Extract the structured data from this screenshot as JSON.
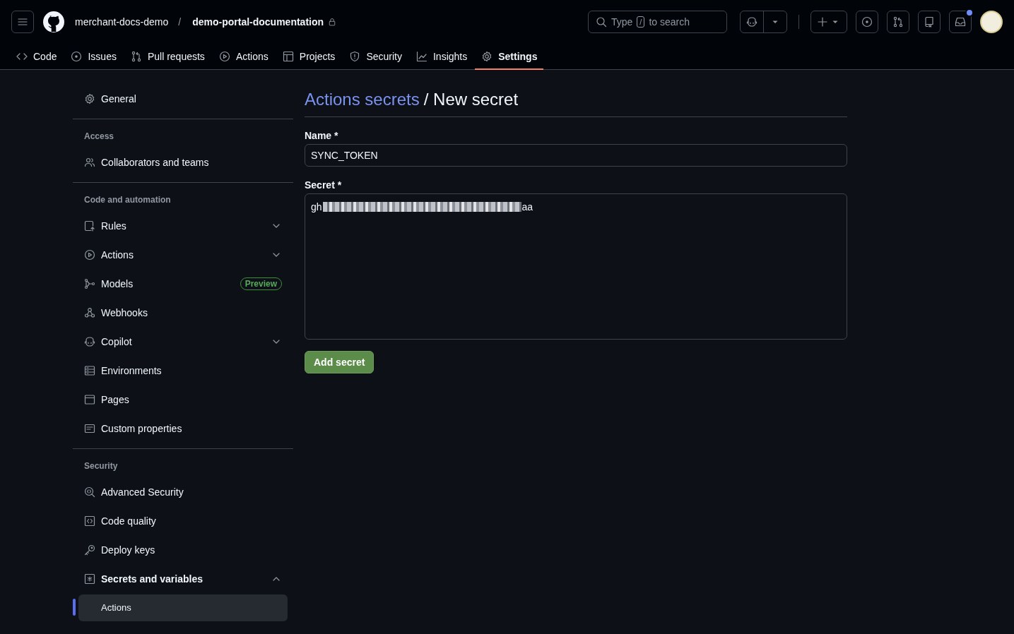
{
  "header": {
    "owner": "merchant-docs-demo",
    "separator": "/",
    "repo": "demo-portal-documentation",
    "private": true,
    "search": {
      "placeholder_before": "Type",
      "key": "/",
      "placeholder_after": "to search"
    },
    "notifications": {
      "unread": true
    }
  },
  "tabs": [
    {
      "label": "Code",
      "selected": false
    },
    {
      "label": "Issues",
      "selected": false
    },
    {
      "label": "Pull requests",
      "selected": false
    },
    {
      "label": "Actions",
      "selected": false
    },
    {
      "label": "Projects",
      "selected": false
    },
    {
      "label": "Security",
      "selected": false
    },
    {
      "label": "Insights",
      "selected": false
    },
    {
      "label": "Settings",
      "selected": true
    }
  ],
  "sidebar": {
    "sections": [
      {
        "items": [
          {
            "label": "General",
            "kind": "link"
          }
        ]
      },
      {
        "heading": "Access",
        "items": [
          {
            "label": "Collaborators and teams",
            "kind": "link"
          }
        ]
      },
      {
        "heading": "Code and automation",
        "items": [
          {
            "label": "Rules",
            "kind": "group",
            "expanded": false
          },
          {
            "label": "Actions",
            "kind": "group",
            "expanded": false
          },
          {
            "label": "Models",
            "kind": "link",
            "badge": "Preview"
          },
          {
            "label": "Webhooks",
            "kind": "link"
          },
          {
            "label": "Copilot",
            "kind": "group",
            "expanded": false
          },
          {
            "label": "Environments",
            "kind": "link"
          },
          {
            "label": "Pages",
            "kind": "link"
          },
          {
            "label": "Custom properties",
            "kind": "link"
          }
        ]
      },
      {
        "heading": "Security",
        "items": [
          {
            "label": "Advanced Security",
            "kind": "link"
          },
          {
            "label": "Code quality",
            "kind": "link"
          },
          {
            "label": "Deploy keys",
            "kind": "link"
          },
          {
            "label": "Secrets and variables",
            "kind": "group",
            "expanded": true,
            "children": [
              {
                "label": "Actions",
                "selected": true
              }
            ]
          }
        ]
      }
    ]
  },
  "form": {
    "breadcrumb": "Actions secrets",
    "title": "/ New secret",
    "name_label": "Name *",
    "name_value": "SYNC_TOKEN",
    "secret_label": "Secret *",
    "secret_start": "gh",
    "secret_redacted": true,
    "secret_end": "aa",
    "submit": "Add secret"
  }
}
